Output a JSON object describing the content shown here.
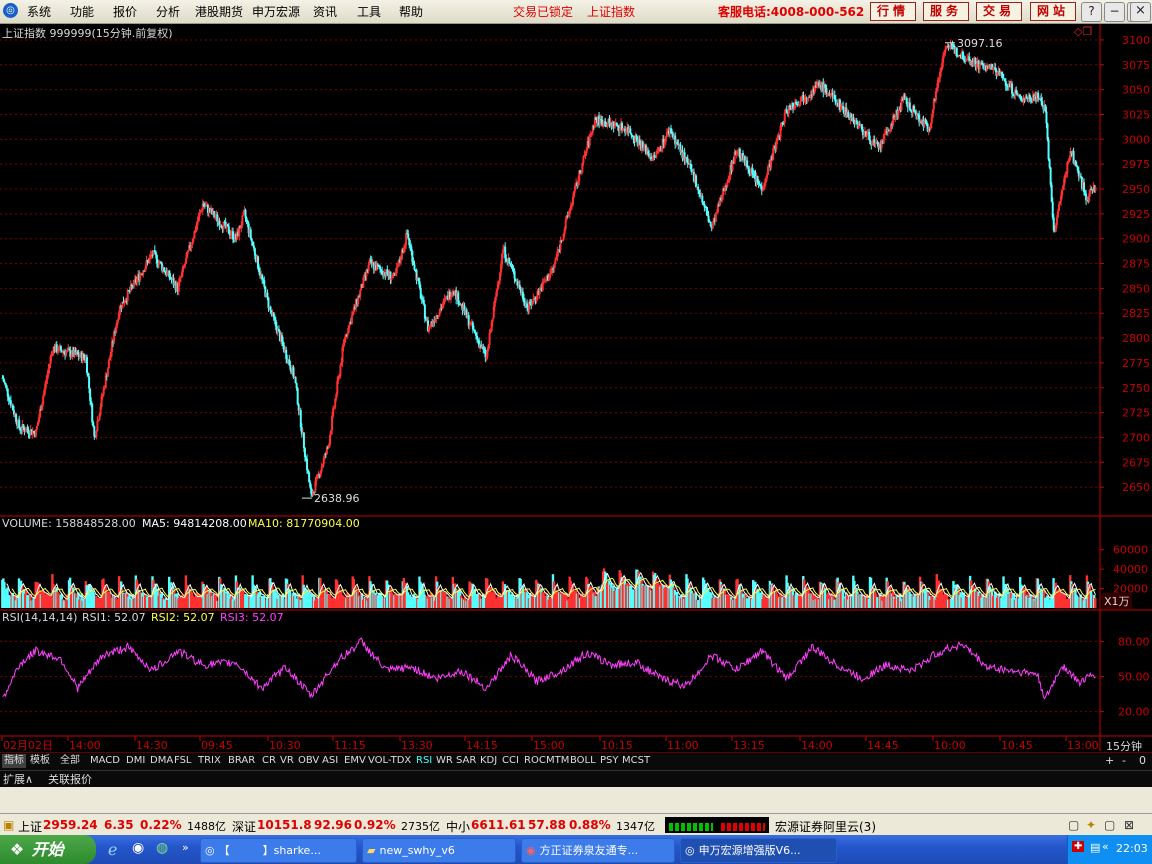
{
  "menu": {
    "items": [
      "系统",
      "功能",
      "报价",
      "分析",
      "港股期货",
      "申万宏源",
      "资讯",
      "工具",
      "帮助"
    ],
    "lock_status": "交易已锁定",
    "current_symbol": "上证指数",
    "hotline": "客服电话:4008-000-562",
    "buttons": [
      "行情",
      "服务",
      "交易",
      "网站"
    ]
  },
  "chart_header": {
    "title": "上证指数 999999(15分钟.前复权)"
  },
  "volume_header": {
    "volume": "VOLUME: 158848528.00",
    "ma5": "MA5: 94814208.00",
    "ma10": "MA10: 81770904.00"
  },
  "rsi_header": {
    "name": "RSI(14,14,14)",
    "rsi1": "RSI1: 52.07",
    "rsi2": "RSI2: 52.07",
    "rsi3": "RSI3: 52.07"
  },
  "volume_unit": "X1万",
  "period_label": "15分钟",
  "panel_buttons": [
    "+",
    "-",
    "0"
  ],
  "indicator_tabs": [
    "指标",
    "模板",
    "全部",
    "MACD",
    "DMI",
    "DMA",
    "FSL",
    "TRIX",
    "BRAR",
    "CR",
    "VR",
    "OBV",
    "ASI",
    "EMV",
    "VOL-TDX",
    "RSI",
    "WR",
    "SAR",
    "KDJ",
    "CCI",
    "ROC",
    "MTM",
    "BOLL",
    "PSY",
    "MCST"
  ],
  "active_tab": "RSI",
  "sub_tabs": [
    "扩展∧",
    "关联报价"
  ],
  "status": {
    "sh_label": "上证",
    "sh_value": "2959.24",
    "sh_change": "6.35",
    "sh_pct": "0.22%",
    "sh_amount": "1488亿",
    "sz_label": "深证",
    "sz_value": "10151.8",
    "sz_change": "92.96",
    "sz_pct": "0.92%",
    "sz_amount": "2735亿",
    "sme_label": "中小",
    "sme_value": "6611.61",
    "sme_change": "57.88",
    "sme_pct": "0.88%",
    "sme_amount": "1347亿",
    "broker": "宏源证券阿里云(3)"
  },
  "taskbar": {
    "start": "开始",
    "tasks": [
      "【　　　】sharke...",
      "new_swhy_v6",
      "方正证券泉友通专...",
      "申万宏源增强版V6..."
    ],
    "clock": "22:03"
  },
  "colors": {
    "up": "#ff3030",
    "down": "#54ffff",
    "ma5": "#ffffff",
    "ma10": "#ffff40",
    "rsi": "#ff40ff",
    "axis": "#c80000"
  },
  "chart_data": {
    "type": "candlestick",
    "title": "上证指数 999999(15分钟.前复权)",
    "ylim": [
      2630,
      3110
    ],
    "y_ticks": [
      2650,
      2675,
      2700,
      2725,
      2750,
      2775,
      2800,
      2825,
      2850,
      2875,
      2900,
      2925,
      2950,
      2975,
      3000,
      3025,
      3050,
      3075,
      3100
    ],
    "x_labels": [
      "02月02日",
      "14:00",
      "14:30",
      "09:45",
      "10:30",
      "11:15",
      "13:30",
      "14:15",
      "15:00",
      "10:15",
      "11:00",
      "13:15",
      "14:00",
      "14:45",
      "10:00",
      "10:45",
      "13:00"
    ],
    "annotations": [
      {
        "label": "2638.96",
        "value": 2638.96
      },
      {
        "label": "3097.16",
        "value": 3097.16
      }
    ],
    "price_path": [
      [
        0,
        2760
      ],
      [
        4,
        2710
      ],
      [
        8,
        2705
      ],
      [
        12,
        2790
      ],
      [
        20,
        2780
      ],
      [
        22,
        2700
      ],
      [
        28,
        2830
      ],
      [
        36,
        2885
      ],
      [
        42,
        2850
      ],
      [
        48,
        2935
      ],
      [
        56,
        2900
      ],
      [
        58,
        2925
      ],
      [
        64,
        2830
      ],
      [
        70,
        2760
      ],
      [
        74,
        2640
      ],
      [
        78,
        2690
      ],
      [
        82,
        2800
      ],
      [
        88,
        2875
      ],
      [
        94,
        2860
      ],
      [
        97,
        2905
      ],
      [
        102,
        2810
      ],
      [
        108,
        2850
      ],
      [
        116,
        2780
      ],
      [
        120,
        2890
      ],
      [
        126,
        2830
      ],
      [
        132,
        2870
      ],
      [
        136,
        2930
      ],
      [
        142,
        3020
      ],
      [
        150,
        3010
      ],
      [
        156,
        2980
      ],
      [
        160,
        3010
      ],
      [
        166,
        2960
      ],
      [
        170,
        2910
      ],
      [
        176,
        2990
      ],
      [
        182,
        2950
      ],
      [
        188,
        3030
      ],
      [
        196,
        3055
      ],
      [
        204,
        3020
      ],
      [
        210,
        2990
      ],
      [
        216,
        3040
      ],
      [
        222,
        3010
      ],
      [
        226,
        3095
      ],
      [
        234,
        3075
      ],
      [
        238,
        3070
      ],
      [
        244,
        3040
      ],
      [
        248,
        3045
      ],
      [
        250,
        3030
      ],
      [
        252,
        2905
      ],
      [
        256,
        2990
      ],
      [
        260,
        2940
      ],
      [
        262,
        2955
      ]
    ],
    "volume": {
      "ylim": [
        0,
        70000
      ],
      "y_ticks": [
        20000,
        40000,
        60000
      ],
      "unit": "X1万"
    },
    "rsi": {
      "ylim": [
        0,
        100
      ],
      "y_ticks": [
        20,
        50,
        80
      ],
      "rsi_path": [
        [
          0,
          30
        ],
        [
          4,
          60
        ],
        [
          8,
          72
        ],
        [
          14,
          65
        ],
        [
          18,
          40
        ],
        [
          24,
          68
        ],
        [
          30,
          75
        ],
        [
          36,
          55
        ],
        [
          42,
          72
        ],
        [
          48,
          60
        ],
        [
          56,
          62
        ],
        [
          62,
          40
        ],
        [
          68,
          58
        ],
        [
          74,
          33
        ],
        [
          80,
          62
        ],
        [
          86,
          80
        ],
        [
          92,
          55
        ],
        [
          98,
          58
        ],
        [
          104,
          48
        ],
        [
          110,
          55
        ],
        [
          116,
          40
        ],
        [
          122,
          68
        ],
        [
          128,
          46
        ],
        [
          134,
          55
        ],
        [
          140,
          70
        ],
        [
          146,
          60
        ],
        [
          152,
          62
        ],
        [
          158,
          48
        ],
        [
          164,
          42
        ],
        [
          170,
          68
        ],
        [
          176,
          56
        ],
        [
          182,
          72
        ],
        [
          188,
          48
        ],
        [
          194,
          75
        ],
        [
          200,
          60
        ],
        [
          206,
          48
        ],
        [
          212,
          60
        ],
        [
          218,
          55
        ],
        [
          224,
          70
        ],
        [
          230,
          78
        ],
        [
          236,
          58
        ],
        [
          242,
          55
        ],
        [
          248,
          52
        ],
        [
          250,
          30
        ],
        [
          254,
          60
        ],
        [
          258,
          45
        ],
        [
          262,
          52
        ]
      ]
    }
  }
}
